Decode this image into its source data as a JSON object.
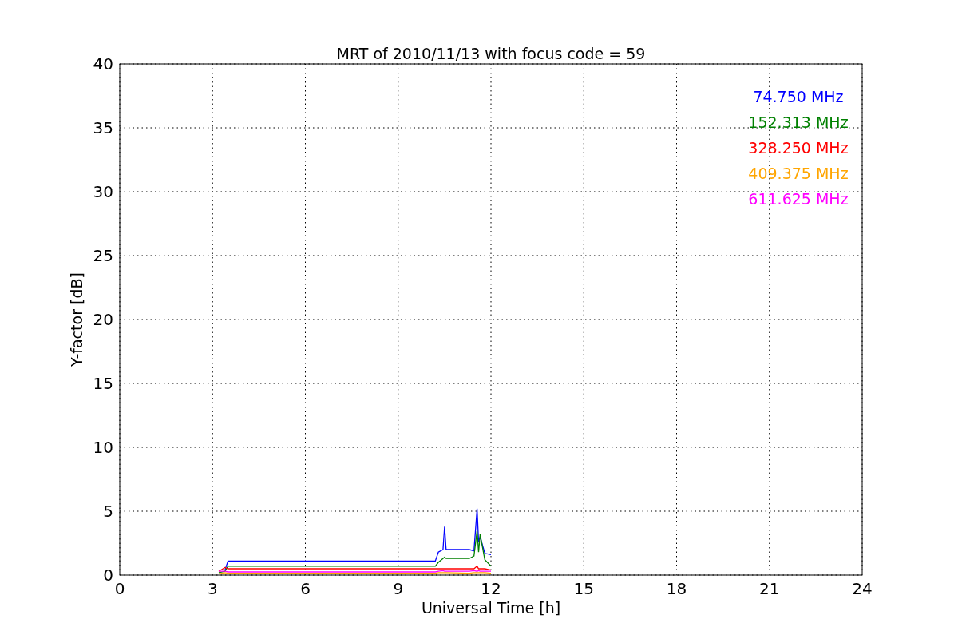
{
  "chart_data": {
    "type": "line",
    "title": "MRT of 2010/11/13 with focus code = 59",
    "xlabel": "Universal Time [h]",
    "ylabel": "Y-factor [dB]",
    "x": [
      3.2,
      3.4,
      3.5,
      10.2,
      10.3,
      10.45,
      10.5,
      10.55,
      11.3,
      11.45,
      11.55,
      11.6,
      11.65,
      11.8,
      12.0
    ],
    "series": [
      {
        "name": "74.750 MHz",
        "color": "#0000ff",
        "values": [
          null,
          0.4,
          1.1,
          1.1,
          1.8,
          2.0,
          3.8,
          2.0,
          2.0,
          1.9,
          5.2,
          2.6,
          3.0,
          1.7,
          1.6
        ]
      },
      {
        "name": "152.313 MHz",
        "color": "#008000",
        "values": [
          0.2,
          0.3,
          0.7,
          0.7,
          1.0,
          1.3,
          1.4,
          1.3,
          1.3,
          1.5,
          3.5,
          1.8,
          3.2,
          1.2,
          0.7
        ]
      },
      {
        "name": "328.250 MHz",
        "color": "#ff0000",
        "values": [
          0.3,
          0.6,
          0.5,
          0.5,
          0.5,
          0.5,
          0.5,
          0.5,
          0.5,
          0.5,
          0.7,
          0.5,
          0.5,
          0.5,
          0.4
        ]
      },
      {
        "name": "409.375 MHz",
        "color": "#ffa500",
        "values": [
          0.1,
          0.2,
          0.15,
          0.15,
          0.2,
          0.2,
          0.2,
          0.2,
          0.15,
          0.2,
          0.2,
          0.2,
          0.2,
          0.2,
          0.15
        ]
      },
      {
        "name": "611.625 MHz",
        "color": "#ff00ff",
        "values": [
          0.3,
          0.3,
          0.25,
          0.25,
          0.3,
          0.35,
          0.3,
          0.3,
          0.3,
          0.35,
          0.3,
          0.35,
          0.3,
          0.3,
          0.3
        ]
      }
    ],
    "grid": true,
    "xlim": [
      0,
      24
    ],
    "ylim": [
      0,
      40
    ],
    "xticks": [
      0,
      3,
      6,
      9,
      12,
      15,
      18,
      21,
      24
    ],
    "yticks": [
      0,
      5,
      10,
      15,
      20,
      25,
      30,
      35,
      40
    ]
  }
}
